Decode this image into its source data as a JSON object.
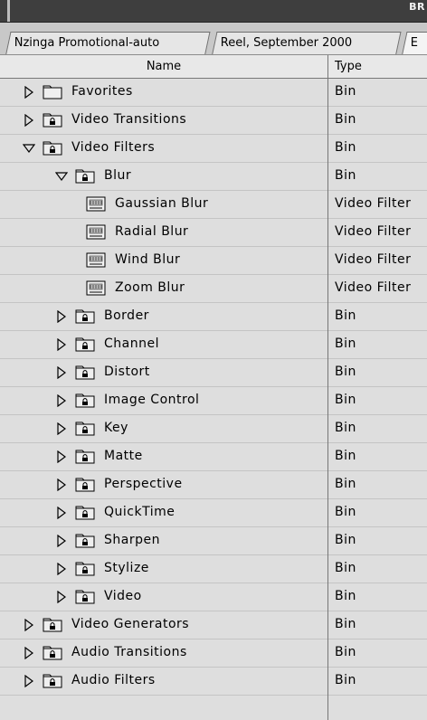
{
  "window": {
    "title": "BR"
  },
  "tabs": [
    {
      "label": "Nzinga Promotional-auto",
      "active": false
    },
    {
      "label": "Reel, September 2000",
      "active": false
    },
    {
      "label": "E",
      "active": true
    }
  ],
  "columns": {
    "name": "Name",
    "type": "Type"
  },
  "rows": [
    {
      "name": "Favorites",
      "type": "Bin",
      "level": 0,
      "icon": "folder",
      "toggle": "collapsed",
      "locked": false
    },
    {
      "name": "Video Transitions",
      "type": "Bin",
      "level": 0,
      "icon": "folder",
      "toggle": "collapsed",
      "locked": true
    },
    {
      "name": "Video Filters",
      "type": "Bin",
      "level": 0,
      "icon": "folder",
      "toggle": "expanded",
      "locked": true
    },
    {
      "name": "Blur",
      "type": "Bin",
      "level": 1,
      "icon": "folder",
      "toggle": "expanded",
      "locked": true
    },
    {
      "name": "Gaussian Blur",
      "type": "Video Filter",
      "level": 2,
      "icon": "filter",
      "toggle": "none",
      "locked": false
    },
    {
      "name": "Radial Blur",
      "type": "Video Filter",
      "level": 2,
      "icon": "filter",
      "toggle": "none",
      "locked": false
    },
    {
      "name": "Wind Blur",
      "type": "Video Filter",
      "level": 2,
      "icon": "filter",
      "toggle": "none",
      "locked": false
    },
    {
      "name": "Zoom Blur",
      "type": "Video Filter",
      "level": 2,
      "icon": "filter",
      "toggle": "none",
      "locked": false
    },
    {
      "name": "Border",
      "type": "Bin",
      "level": 1,
      "icon": "folder",
      "toggle": "collapsed",
      "locked": true
    },
    {
      "name": "Channel",
      "type": "Bin",
      "level": 1,
      "icon": "folder",
      "toggle": "collapsed",
      "locked": true
    },
    {
      "name": "Distort",
      "type": "Bin",
      "level": 1,
      "icon": "folder",
      "toggle": "collapsed",
      "locked": true
    },
    {
      "name": "Image Control",
      "type": "Bin",
      "level": 1,
      "icon": "folder",
      "toggle": "collapsed",
      "locked": true
    },
    {
      "name": "Key",
      "type": "Bin",
      "level": 1,
      "icon": "folder",
      "toggle": "collapsed",
      "locked": true
    },
    {
      "name": "Matte",
      "type": "Bin",
      "level": 1,
      "icon": "folder",
      "toggle": "collapsed",
      "locked": true
    },
    {
      "name": "Perspective",
      "type": "Bin",
      "level": 1,
      "icon": "folder",
      "toggle": "collapsed",
      "locked": true
    },
    {
      "name": "QuickTime",
      "type": "Bin",
      "level": 1,
      "icon": "folder",
      "toggle": "collapsed",
      "locked": true
    },
    {
      "name": "Sharpen",
      "type": "Bin",
      "level": 1,
      "icon": "folder",
      "toggle": "collapsed",
      "locked": true
    },
    {
      "name": "Stylize",
      "type": "Bin",
      "level": 1,
      "icon": "folder",
      "toggle": "collapsed",
      "locked": true
    },
    {
      "name": "Video",
      "type": "Bin",
      "level": 1,
      "icon": "folder",
      "toggle": "collapsed",
      "locked": true
    },
    {
      "name": "Video Generators",
      "type": "Bin",
      "level": 0,
      "icon": "folder",
      "toggle": "collapsed",
      "locked": true
    },
    {
      "name": "Audio Transitions",
      "type": "Bin",
      "level": 0,
      "icon": "folder",
      "toggle": "collapsed",
      "locked": true
    },
    {
      "name": "Audio Filters",
      "type": "Bin",
      "level": 0,
      "icon": "folder",
      "toggle": "collapsed",
      "locked": true
    }
  ]
}
